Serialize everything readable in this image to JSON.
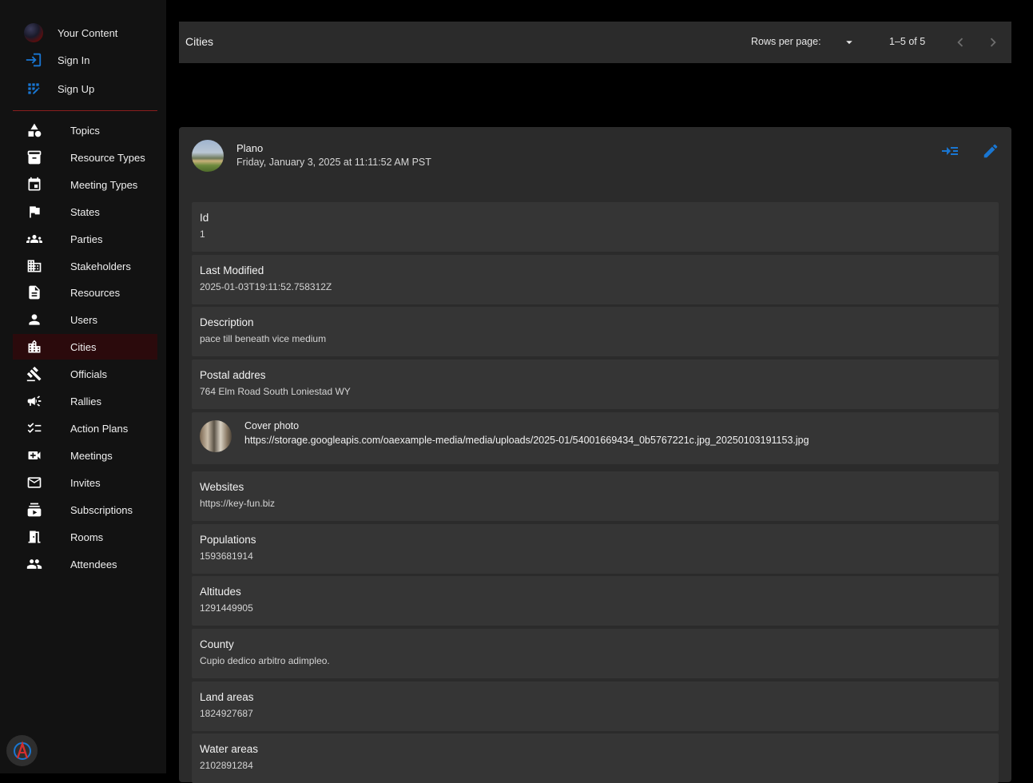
{
  "account": {
    "items": [
      {
        "label": "Your Content",
        "icon": "avatar-icon"
      },
      {
        "label": "Sign In",
        "icon": "login-icon"
      },
      {
        "label": "Sign Up",
        "icon": "app-registration-icon"
      }
    ]
  },
  "sidebar": {
    "items": [
      {
        "label": "Topics",
        "icon": "category-icon"
      },
      {
        "label": "Resource Types",
        "icon": "archive-icon"
      },
      {
        "label": "Meeting Types",
        "icon": "event-icon"
      },
      {
        "label": "States",
        "icon": "flag-icon"
      },
      {
        "label": "Parties",
        "icon": "groups-icon"
      },
      {
        "label": "Stakeholders",
        "icon": "domain-icon"
      },
      {
        "label": "Resources",
        "icon": "description-icon"
      },
      {
        "label": "Users",
        "icon": "person-icon"
      },
      {
        "label": "Cities",
        "icon": "location-city-icon"
      },
      {
        "label": "Officials",
        "icon": "gavel-icon"
      },
      {
        "label": "Rallies",
        "icon": "campaign-icon"
      },
      {
        "label": "Action Plans",
        "icon": "checklist-icon"
      },
      {
        "label": "Meetings",
        "icon": "video-call-icon"
      },
      {
        "label": "Invites",
        "icon": "mail-icon"
      },
      {
        "label": "Subscriptions",
        "icon": "subscriptions-icon"
      },
      {
        "label": "Rooms",
        "icon": "door-icon"
      },
      {
        "label": "Attendees",
        "icon": "people-icon"
      }
    ],
    "active": "Cities"
  },
  "toolbar": {
    "title": "Cities",
    "rows_per_page_label": "Rows per page:",
    "range": "1–5 of 5"
  },
  "record": {
    "title": "Plano",
    "subtitle": "Friday, January 3, 2025 at 11:11:52 AM PST",
    "fields": [
      {
        "label": "Id",
        "value": "1"
      },
      {
        "label": "Last Modified",
        "value": "2025-01-03T19:11:52.758312Z"
      },
      {
        "label": "Description",
        "value": "pace till beneath vice medium"
      },
      {
        "label": "Postal addres",
        "value": "764 Elm Road South Loniestad WY"
      },
      {
        "label": "Cover photo",
        "value": "https://storage.googleapis.com/oaexample-media/media/uploads/2025-01/54001669434_0b5767221c.jpg_20250103191153.jpg"
      },
      {
        "label": "Websites",
        "value": "https://key-fun.biz"
      },
      {
        "label": "Populations",
        "value": "1593681914"
      },
      {
        "label": "Altitudes",
        "value": "1291449905"
      },
      {
        "label": "County",
        "value": "Cupio dedico arbitro adimpleo."
      },
      {
        "label": "Land areas",
        "value": "1824927687"
      },
      {
        "label": "Water areas",
        "value": "2102891284"
      }
    ]
  },
  "colors": {
    "accent_blue": "#1976d2",
    "active_bg": "#2b0a0c",
    "divider_red": "#8a1e1e",
    "panel": "#2b2b2b",
    "field_bg": "#353535"
  }
}
